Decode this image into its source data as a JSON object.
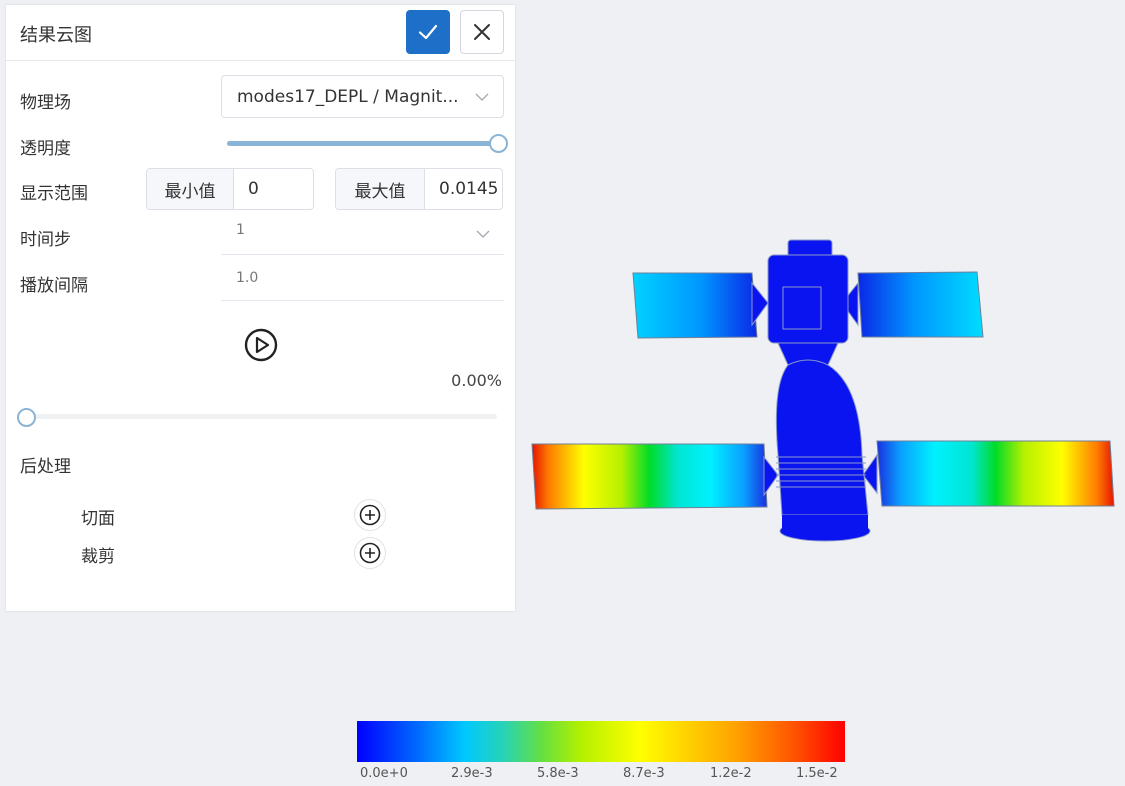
{
  "panel": {
    "title": "结果云图",
    "confirm_icon": "check-icon",
    "close_icon": "close-icon"
  },
  "fields": {
    "physics_label": "物理场",
    "physics_value": "modes17_DEPL / Magnit...",
    "opacity_label": "透明度",
    "opacity_value": 1.0,
    "range_label": "显示范围",
    "min_label": "最小值",
    "min_value": "0",
    "max_label": "最大值",
    "max_value": "0.0145",
    "timestep_label": "时间步",
    "timestep_value": "1",
    "interval_label": "播放间隔",
    "interval_value": "1.0"
  },
  "playback": {
    "play_icon": "play-circle-icon",
    "progress_text": "0.00%",
    "progress_value": 0
  },
  "postprocess": {
    "title": "后处理",
    "items": [
      {
        "label": "切面",
        "icon": "plus-circle-icon"
      },
      {
        "label": "裁剪",
        "icon": "plus-circle-icon"
      }
    ]
  },
  "colorbar": {
    "ticks": [
      "0.0e+0",
      "2.9e-3",
      "5.8e-3",
      "8.7e-3",
      "1.2e-2",
      "1.5e-2"
    ],
    "colors": [
      "#0000ff",
      "#00c8ff",
      "#66e040",
      "#ffff00",
      "#ffa000",
      "#ff0000"
    ]
  },
  "viewport": {
    "model": "satellite-with-solar-panels",
    "body_color": "#0a14f0"
  }
}
